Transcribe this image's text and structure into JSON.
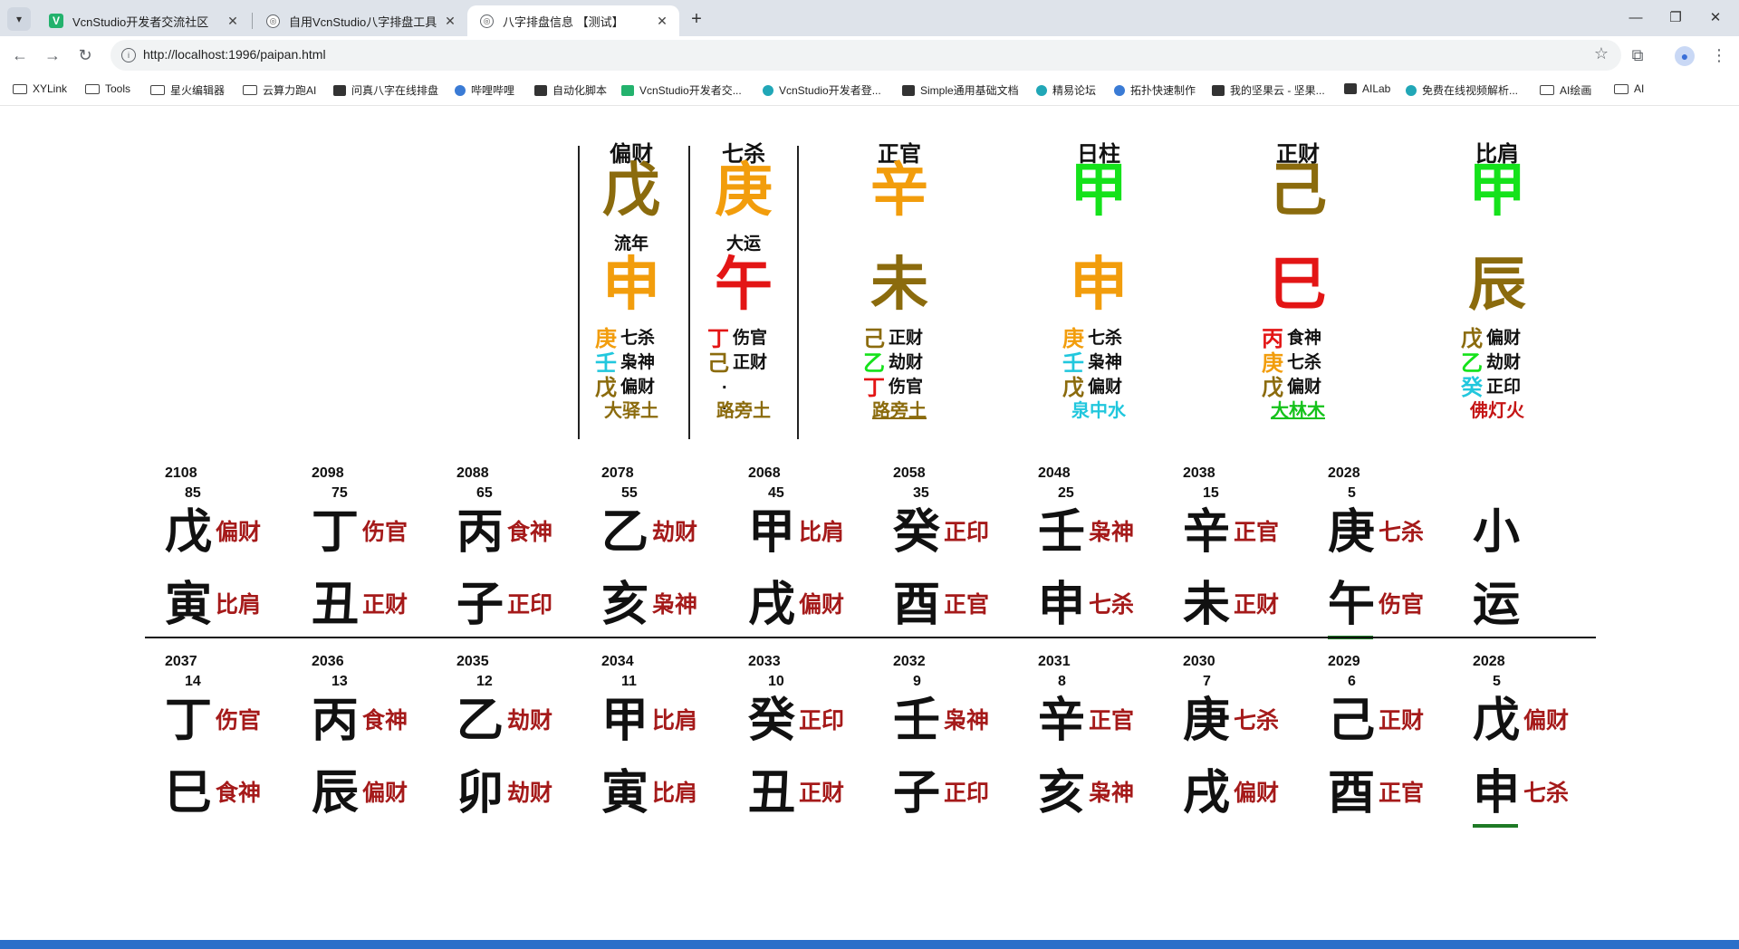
{
  "browser": {
    "tabs": [
      {
        "label": "VcnStudio开发者交流社区",
        "favicon": "vcn-green-icon",
        "active": false
      },
      {
        "label": "自用VcnStudio八字排盘工具",
        "favicon": "globe-icon",
        "active": false
      },
      {
        "label": "八字排盘信息 【测试】",
        "favicon": "globe-icon",
        "active": true
      }
    ],
    "url": "http://localhost:1996/paipan.html",
    "bookmarks": [
      {
        "label": "XYLink",
        "icon": "folder-icon"
      },
      {
        "label": "Tools",
        "icon": "folder-icon"
      },
      {
        "label": "星火编辑器",
        "icon": "folder-icon"
      },
      {
        "label": "云算力跑AI",
        "icon": "folder-icon"
      },
      {
        "label": "问真八字在线排盘",
        "icon": "site-icon"
      },
      {
        "label": "哔哩哔哩",
        "icon": "bilibili-icon"
      },
      {
        "label": "自动化脚本",
        "icon": "script-icon"
      },
      {
        "label": "VcnStudio开发者交...",
        "icon": "vcn-green-icon"
      },
      {
        "label": "VcnStudio开发者登...",
        "icon": "globe-icon"
      },
      {
        "label": "Simple通用基础文档",
        "icon": "doc-icon"
      },
      {
        "label": "精易论坛",
        "icon": "eye-icon"
      },
      {
        "label": "拓扑快速制作",
        "icon": "tool-icon"
      },
      {
        "label": "我的坚果云 - 坚果...",
        "icon": "nut-icon"
      },
      {
        "label": "AILab",
        "icon": "ai-icon"
      },
      {
        "label": "免费在线视频解析...",
        "icon": "video-icon"
      },
      {
        "label": "AI绘画",
        "icon": "folder-icon"
      },
      {
        "label": "AI",
        "icon": "folder-icon"
      }
    ]
  },
  "pillars": [
    {
      "title": "偏财",
      "gan": "戊",
      "gan_color": "#8b6b0d",
      "label": "流年",
      "zhi": "申",
      "zhi_color": "#f29d0c",
      "hidden": [
        {
          "c": "庚",
          "color": "#f29d0c",
          "god": "七杀"
        },
        {
          "c": "壬",
          "color": "#21c7dd",
          "god": "枭神"
        },
        {
          "c": "戊",
          "color": "#8b6b0d",
          "god": "偏财"
        }
      ],
      "nayin": "大驿土",
      "nayin_color": "#8b6b0d",
      "nayin_underline": false
    },
    {
      "title": "七杀",
      "gan": "庚",
      "gan_color": "#f29d0c",
      "label": "大运",
      "zhi": "午",
      "zhi_color": "#e31515",
      "hidden": [
        {
          "c": "丁",
          "color": "#e31515",
          "god": "伤官"
        },
        {
          "c": "己",
          "color": "#8b6b0d",
          "god": "正财"
        }
      ],
      "dots": ". .",
      "nayin": "路旁土",
      "nayin_color": "#8b6b0d",
      "nayin_underline": false
    },
    {
      "title": "正官",
      "gan": "辛",
      "gan_color": "#f29d0c",
      "label": "",
      "zhi": "未",
      "zhi_color": "#8b6b0d",
      "hidden": [
        {
          "c": "己",
          "color": "#8b6b0d",
          "god": "正财"
        },
        {
          "c": "乙",
          "color": "#15e21b",
          "god": "劫财"
        },
        {
          "c": "丁",
          "color": "#e31515",
          "god": "伤官"
        }
      ],
      "nayin": "路旁土",
      "nayin_color": "#8b6b0d",
      "nayin_underline": true
    },
    {
      "title": "日柱",
      "gan": "甲",
      "gan_color": "#15e21b",
      "label": "",
      "zhi": "申",
      "zhi_color": "#f29d0c",
      "hidden": [
        {
          "c": "庚",
          "color": "#f29d0c",
          "god": "七杀"
        },
        {
          "c": "壬",
          "color": "#21c7dd",
          "god": "枭神"
        },
        {
          "c": "戊",
          "color": "#8b6b0d",
          "god": "偏财"
        }
      ],
      "nayin": "泉中水",
      "nayin_color": "#21c7dd",
      "nayin_underline": false
    },
    {
      "title": "正财",
      "gan": "己",
      "gan_color": "#8b6b0d",
      "label": "",
      "zhi": "巳",
      "zhi_color": "#e31515",
      "hidden": [
        {
          "c": "丙",
          "color": "#e31515",
          "god": "食神"
        },
        {
          "c": "庚",
          "color": "#f29d0c",
          "god": "七杀"
        },
        {
          "c": "戊",
          "color": "#8b6b0d",
          "god": "偏财"
        }
      ],
      "nayin": "大林木",
      "nayin_color": "#15c21b",
      "nayin_underline": true
    },
    {
      "title": "比肩",
      "gan": "甲",
      "gan_color": "#15e21b",
      "label": "",
      "zhi": "辰",
      "zhi_color": "#8b6b0d",
      "hidden": [
        {
          "c": "戊",
          "color": "#8b6b0d",
          "god": "偏财"
        },
        {
          "c": "乙",
          "color": "#15e21b",
          "god": "劫财"
        },
        {
          "c": "癸",
          "color": "#21c7dd",
          "god": "正印"
        }
      ],
      "nayin": "佛灯火",
      "nayin_color": "#c51616",
      "nayin_underline": false
    }
  ],
  "dayun": [
    {
      "year": "2108",
      "age": "85",
      "gan": "戊",
      "gan_god": "偏财",
      "zhi": "寅",
      "zhi_god": "比肩"
    },
    {
      "year": "2098",
      "age": "75",
      "gan": "丁",
      "gan_god": "伤官",
      "zhi": "丑",
      "zhi_god": "正财"
    },
    {
      "year": "2088",
      "age": "65",
      "gan": "丙",
      "gan_god": "食神",
      "zhi": "子",
      "zhi_god": "正印"
    },
    {
      "year": "2078",
      "age": "55",
      "gan": "乙",
      "gan_god": "劫财",
      "zhi": "亥",
      "zhi_god": "枭神"
    },
    {
      "year": "2068",
      "age": "45",
      "gan": "甲",
      "gan_god": "比肩",
      "zhi": "戌",
      "zhi_god": "偏财"
    },
    {
      "year": "2058",
      "age": "35",
      "gan": "癸",
      "gan_god": "正印",
      "zhi": "酉",
      "zhi_god": "正官"
    },
    {
      "year": "2048",
      "age": "25",
      "gan": "壬",
      "gan_god": "枭神",
      "zhi": "申",
      "zhi_god": "七杀"
    },
    {
      "year": "2038",
      "age": "15",
      "gan": "辛",
      "gan_god": "正官",
      "zhi": "未",
      "zhi_god": "正财"
    },
    {
      "year": "2028",
      "age": "5",
      "gan": "庚",
      "gan_god": "七杀",
      "zhi": "午",
      "zhi_god": "伤官",
      "current": true
    },
    {
      "year": "",
      "age": "",
      "gan": "小",
      "gan_god": "",
      "zhi": "运",
      "zhi_god": ""
    }
  ],
  "liunian": [
    {
      "year": "2037",
      "age": "14",
      "gan": "丁",
      "gan_god": "伤官",
      "zhi": "巳",
      "zhi_god": "食神"
    },
    {
      "year": "2036",
      "age": "13",
      "gan": "丙",
      "gan_god": "食神",
      "zhi": "辰",
      "zhi_god": "偏财"
    },
    {
      "year": "2035",
      "age": "12",
      "gan": "乙",
      "gan_god": "劫财",
      "zhi": "卯",
      "zhi_god": "劫财"
    },
    {
      "year": "2034",
      "age": "11",
      "gan": "甲",
      "gan_god": "比肩",
      "zhi": "寅",
      "zhi_god": "比肩"
    },
    {
      "year": "2033",
      "age": "10",
      "gan": "癸",
      "gan_god": "正印",
      "zhi": "丑",
      "zhi_god": "正财"
    },
    {
      "year": "2032",
      "age": "9",
      "gan": "壬",
      "gan_god": "枭神",
      "zhi": "子",
      "zhi_god": "正印"
    },
    {
      "year": "2031",
      "age": "8",
      "gan": "辛",
      "gan_god": "正官",
      "zhi": "亥",
      "zhi_god": "枭神"
    },
    {
      "year": "2030",
      "age": "7",
      "gan": "庚",
      "gan_god": "七杀",
      "zhi": "戌",
      "zhi_god": "偏财"
    },
    {
      "year": "2029",
      "age": "6",
      "gan": "己",
      "gan_god": "正财",
      "zhi": "酉",
      "zhi_god": "正官"
    },
    {
      "year": "2028",
      "age": "5",
      "gan": "戊",
      "gan_god": "偏财",
      "zhi": "申",
      "zhi_god": "七杀",
      "current": true
    }
  ]
}
